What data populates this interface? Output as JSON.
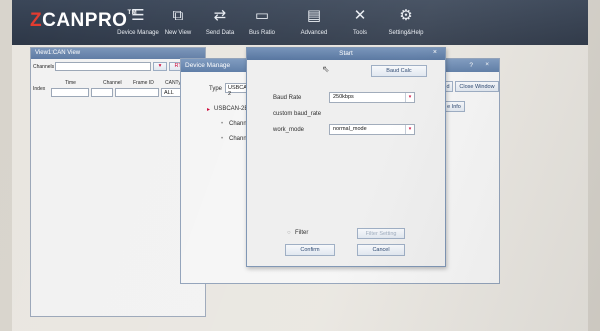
{
  "app": {
    "logo_prefix": "Z",
    "logo_main": "CANPRO",
    "logo_tm": "TM"
  },
  "toolbar": [
    {
      "label": "Device Manage",
      "icon": "device-manage-icon"
    },
    {
      "label": "New View",
      "icon": "new-view-icon"
    },
    {
      "label": "Send Data",
      "icon": "send-data-icon"
    },
    {
      "label": "Bus Ratio",
      "icon": "bus-ratio-icon"
    },
    {
      "label": "Advanced",
      "icon": "advanced-icon"
    },
    {
      "label": "Tools",
      "icon": "tools-icon"
    },
    {
      "label": "Setting&Help",
      "icon": "setting-help-icon"
    }
  ],
  "view_window": {
    "title": "View1:CAN View",
    "channels_label": "Channels",
    "rts_label": "RTS",
    "index_label": "Index",
    "columns": [
      "Time",
      "Channel",
      "Frame ID",
      "CANType"
    ],
    "cantype_value": "ALL"
  },
  "device_window": {
    "title": "Device Manage",
    "type_label": "Type",
    "type_value": "USBCAN-2",
    "device_node": "USBCAN-2E-U",
    "channels": [
      "Channel0",
      "Channel1"
    ],
    "add_button": "d",
    "close_window_button": "Close Window",
    "info_button": "e Info",
    "help_label": "?",
    "close_label": "×"
  },
  "start_dialog": {
    "title": "Start",
    "close_label": "×",
    "baud_calc_button": "Baud Calc",
    "baud_rate_label": "Baud Rate",
    "baud_rate_value": "250kbps",
    "custom_baud_rate_label": "custom baud_rate",
    "work_mode_label": "work_mode",
    "work_mode_value": "normal_mode",
    "filter_label": "Filter",
    "filter_setting_button": "Filter Setting",
    "confirm_button": "Confirm",
    "cancel_button": "Cancel"
  },
  "colors": {
    "toolbar_bg": "#2c3646",
    "title_bar": "#5d7aa3",
    "logo_accent": "#e23a2f",
    "button_text": "#1e3b66"
  }
}
